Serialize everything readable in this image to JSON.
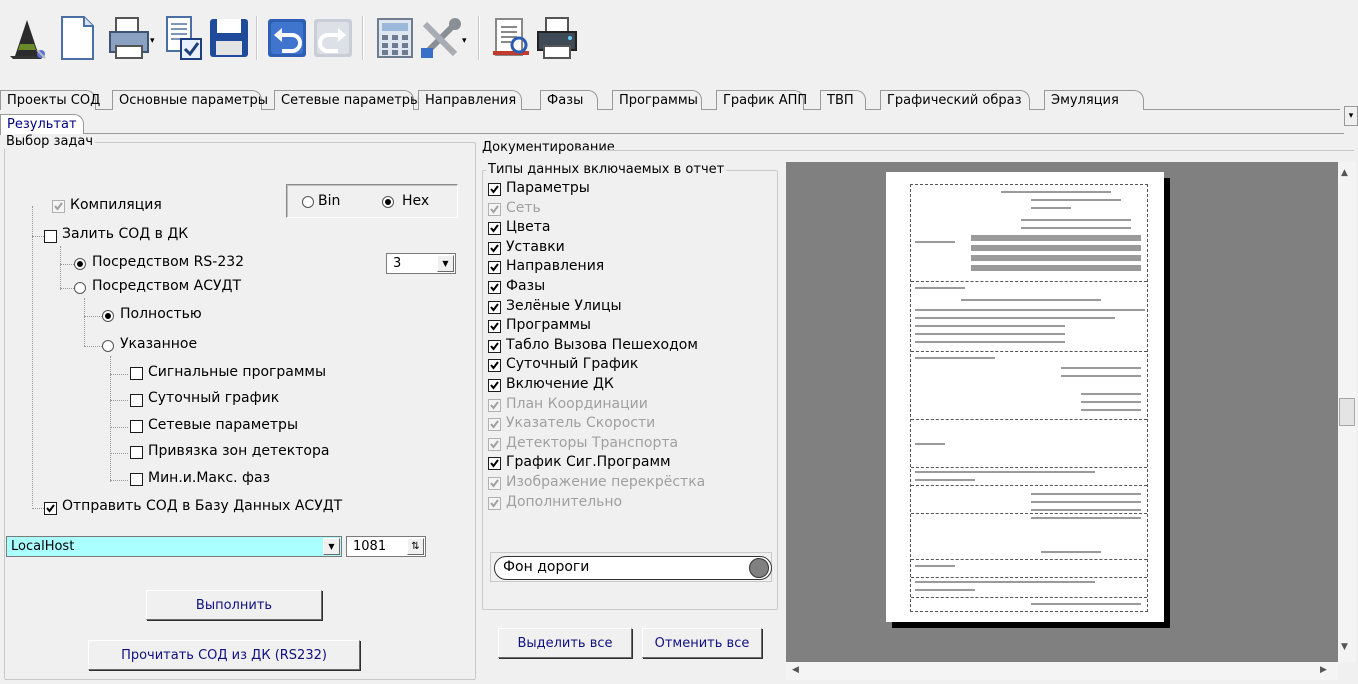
{
  "toolbar": {
    "icons": [
      "wizard-icon",
      "new-document-icon",
      "print-preview-icon",
      "check-document-icon",
      "save-icon",
      "undo-icon",
      "redo-icon",
      "calculator-icon",
      "tools-icon",
      "report-icon",
      "printer-icon"
    ],
    "dropdown_glyph": "▾"
  },
  "tabs": {
    "row1": [
      "Проекты СОД",
      "Основные параметры",
      "Сетевые параметры",
      "Направления",
      "Фазы",
      "Программы",
      "График АПП",
      "ТВП",
      "Графический образ",
      "Эмуляция"
    ],
    "row2_active": "Результат",
    "scroll_glyph": "▾"
  },
  "tasks": {
    "title": "Выбор задач",
    "compile": {
      "label": "Компиляция",
      "checked": true,
      "disabled": true
    },
    "radio_bin": "Bin",
    "radio_hex": "Hex",
    "upload": {
      "label": "Залить СОД в ДК",
      "checked": false
    },
    "via_rs232": "Посредством RS-232",
    "port_value": "3",
    "via_asudt": "Посредством АСУДТ",
    "full": "Полностью",
    "specified": "Указанное",
    "sub_items": [
      "Сигнальные программы",
      "Суточный график",
      "Сетевые параметры",
      "Привязка зон детектора",
      "Мин.и.Макс. фаз"
    ],
    "send_db": {
      "label": "Отправить СОД в Базу Данных АСУДТ",
      "checked": true
    },
    "host_value": "LocalHost",
    "port_number": "1081",
    "execute_button": "Выполнить",
    "read_button": "Прочитать СОД из ДК (RS232)"
  },
  "docs": {
    "title": "Документирование",
    "types_title": "Типы данных включаемых в отчет",
    "items": [
      {
        "label": "Параметры",
        "checked": true,
        "disabled": false
      },
      {
        "label": "Сеть",
        "checked": true,
        "disabled": true
      },
      {
        "label": "Цвета",
        "checked": true,
        "disabled": false
      },
      {
        "label": "Уставки",
        "checked": true,
        "disabled": false
      },
      {
        "label": "Направления",
        "checked": true,
        "disabled": false
      },
      {
        "label": "Фазы",
        "checked": true,
        "disabled": false
      },
      {
        "label": "Зелёные Улицы",
        "checked": true,
        "disabled": false
      },
      {
        "label": "Программы",
        "checked": true,
        "disabled": false
      },
      {
        "label": "Табло Вызова Пешеходом",
        "checked": true,
        "disabled": false
      },
      {
        "label": "Суточный График",
        "checked": true,
        "disabled": false
      },
      {
        "label": "Включение ДК",
        "checked": true,
        "disabled": false
      },
      {
        "label": "План Координации",
        "checked": true,
        "disabled": true
      },
      {
        "label": "Указатель Скорости",
        "checked": true,
        "disabled": true
      },
      {
        "label": "Детекторы Транспорта",
        "checked": true,
        "disabled": true
      },
      {
        "label": "График Сиг.Программ",
        "checked": true,
        "disabled": false
      },
      {
        "label": "Изображение перекрёстка",
        "checked": true,
        "disabled": true
      },
      {
        "label": "Дополнительно",
        "checked": true,
        "disabled": true
      }
    ],
    "color_field": "Фон дороги",
    "select_all": "Выделить все",
    "cancel_all": "Отменить все"
  },
  "colors": {
    "accent": "#000080",
    "selection": "#aaffff",
    "preview_bg": "#808080"
  }
}
